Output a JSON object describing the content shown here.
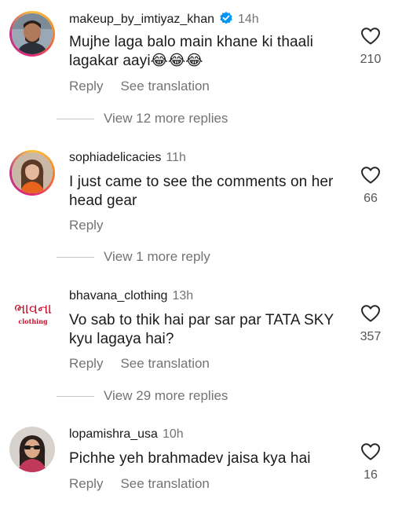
{
  "colors": {
    "text": "#1a1a1a",
    "muted": "#737373",
    "verified": "#0095f6",
    "brand_red": "#c8102e"
  },
  "labels": {
    "reply": "Reply",
    "see_translation": "See translation"
  },
  "comments": [
    {
      "username": "makeup_by_imtiyaz_khan",
      "verified": true,
      "time": "14h",
      "text": "Mujhe laga balo main khane ki thaali lagakar aayi😂😂😂",
      "likes": "210",
      "view_more": "View 12 more replies",
      "avatar_icon": "man-portrait-avatar",
      "has_story_ring": true
    },
    {
      "username": "sophiadelicacies",
      "verified": false,
      "time": "11h",
      "text": "I just came to see the comments on her head gear",
      "likes": "66",
      "view_more": "View 1 more reply",
      "avatar_icon": "woman-portrait-avatar",
      "has_story_ring": true
    },
    {
      "username": "bhavana_clothing",
      "verified": false,
      "time": "13h",
      "text": "Vo sab to thik hai par sar par TATA SKY kyu lagaya hai?",
      "likes": "357",
      "view_more": "View 29 more replies",
      "avatar_icon": "brand-logo",
      "brand_logo_script": "ભાવના",
      "brand_logo_sub": "clothing",
      "has_story_ring": false
    },
    {
      "username": "lopamishra_usa",
      "verified": false,
      "time": "10h",
      "text": "Pichhe yeh brahmadev jaisa kya hai",
      "likes": "16",
      "avatar_icon": "woman-sunglasses-avatar",
      "has_story_ring": false
    }
  ]
}
